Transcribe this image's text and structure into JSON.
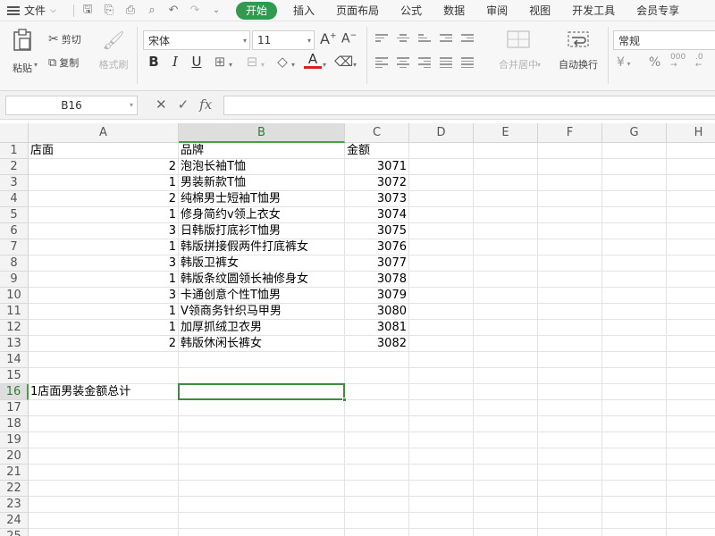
{
  "menubar": {
    "file_label": "文件",
    "tabs": [
      "开始",
      "插入",
      "页面布局",
      "公式",
      "数据",
      "审阅",
      "视图",
      "开发工具",
      "会员专享"
    ],
    "active_tab": "开始"
  },
  "ribbon": {
    "paste_label": "粘贴",
    "cut_label": "剪切",
    "copy_label": "复制",
    "format_painter_label": "格式刷",
    "font_name": "宋体",
    "font_size": "11",
    "merge_label": "合并居中",
    "wrap_label": "自动换行",
    "number_format": "常规",
    "bold_glyph": "B",
    "italic_glyph": "I",
    "underline_glyph": "U",
    "font_color_glyph": "A",
    "grow_glyph": "A",
    "shrink_glyph": "A",
    "currency_glyph": "¥",
    "percent_glyph": "%",
    "thousands_glyph": "000"
  },
  "formula_bar": {
    "name_box": "B16",
    "cancel_glyph": "✕",
    "confirm_glyph": "✓",
    "fx_glyph": "fx",
    "value": ""
  },
  "sheet": {
    "columns": [
      "A",
      "B",
      "C",
      "D",
      "E",
      "F",
      "G",
      "H"
    ],
    "selected_column": "B",
    "row_numbers": [
      "1",
      "2",
      "3",
      "4",
      "5",
      "6",
      "7",
      "8",
      "9",
      "10",
      "11",
      "12",
      "13",
      "14",
      "15",
      "16",
      "17",
      "18",
      "19",
      "20",
      "21",
      "22",
      "23",
      "24",
      "25"
    ],
    "selected_row": "16",
    "header": {
      "a": "店面",
      "b": "品牌",
      "c": "金额"
    },
    "rows": [
      {
        "a": "2",
        "b": "泡泡长袖T恤",
        "c": "3071"
      },
      {
        "a": "1",
        "b": "男装新款T恤",
        "c": "3072"
      },
      {
        "a": "2",
        "b": "纯棉男士短袖T恤男",
        "c": "3073"
      },
      {
        "a": "1",
        "b": "修身简约v领上衣女",
        "c": "3074"
      },
      {
        "a": "3",
        "b": "日韩版打底衫T恤男",
        "c": "3075"
      },
      {
        "a": "1",
        "b": "韩版拼接假两件打底裤女",
        "c": "3076"
      },
      {
        "a": "3",
        "b": "韩版卫裤女",
        "c": "3077"
      },
      {
        "a": "1",
        "b": "韩版条纹圆领长袖修身女",
        "c": "3078"
      },
      {
        "a": "3",
        "b": "卡通创意个性T恤男",
        "c": "3079"
      },
      {
        "a": "1",
        "b": "V领商务针织马甲男",
        "c": "3080"
      },
      {
        "a": "1",
        "b": "加厚抓绒卫衣男",
        "c": "3081"
      },
      {
        "a": "2",
        "b": "韩版休闲长裤女",
        "c": "3082"
      }
    ],
    "a16": "1店面男装金额总计",
    "b16": ""
  }
}
